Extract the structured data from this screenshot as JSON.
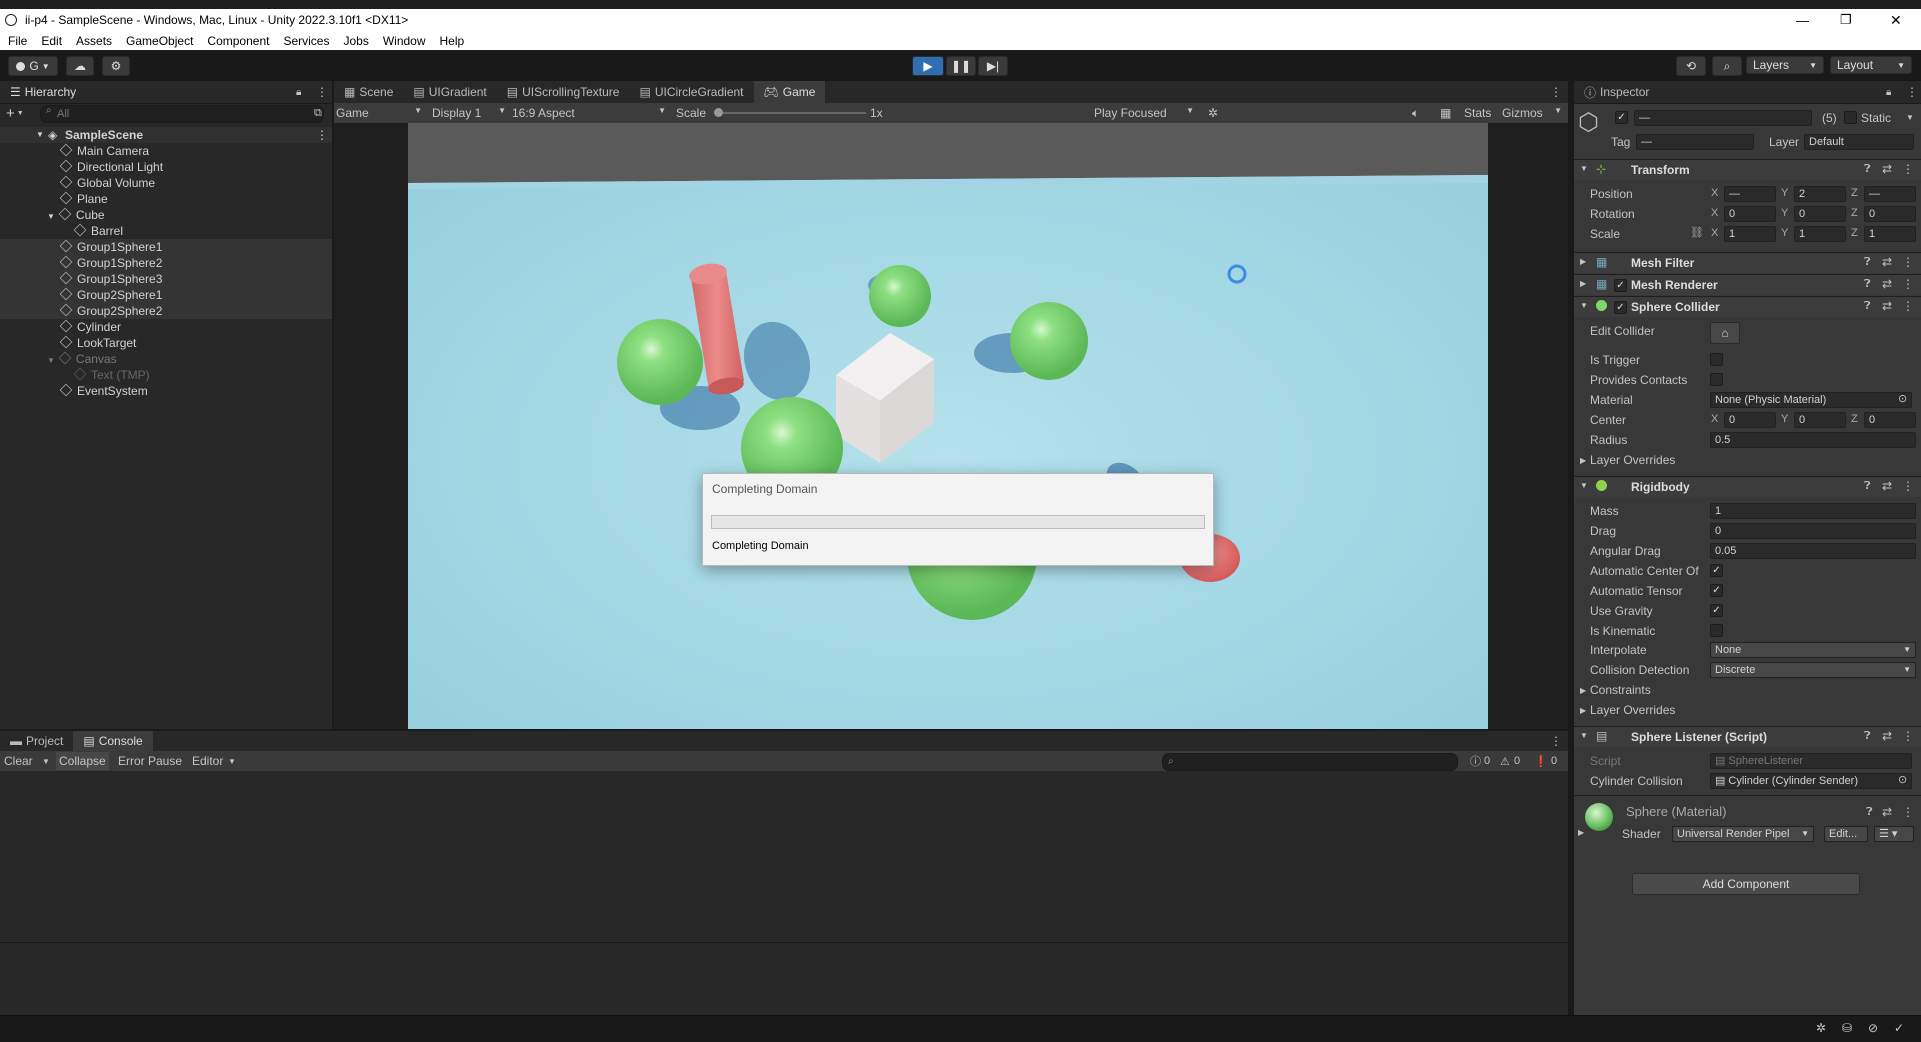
{
  "window": {
    "title": "ii-p4 - SampleScene - Windows, Mac, Linux - Unity 2022.3.10f1 <DX11>",
    "controls": [
      "—",
      "❐",
      "✕"
    ]
  },
  "menu": [
    "File",
    "Edit",
    "Assets",
    "GameObject",
    "Component",
    "Services",
    "Jobs",
    "Window",
    "Help"
  ],
  "toolbar": {
    "account": "G",
    "layers": "Layers",
    "layout": "Layout"
  },
  "hierarchy": {
    "tab": "Hierarchy",
    "search_placeholder": "All",
    "scene": "SampleScene",
    "items": [
      {
        "label": "Main Camera"
      },
      {
        "label": "Directional Light"
      },
      {
        "label": "Global Volume"
      },
      {
        "label": "Plane"
      },
      {
        "label": "Cube"
      },
      {
        "label": "Barrel"
      },
      {
        "label": "Group1Sphere1"
      },
      {
        "label": "Group1Sphere2"
      },
      {
        "label": "Group1Sphere3"
      },
      {
        "label": "Group2Sphere1"
      },
      {
        "label": "Group2Sphere2"
      },
      {
        "label": "Cylinder"
      },
      {
        "label": "LookTarget"
      },
      {
        "label": "Canvas"
      },
      {
        "label": "Text (TMP)"
      },
      {
        "label": "EventSystem"
      }
    ]
  },
  "center_tabs": [
    "Scene",
    "UIGradient",
    "UIScrollingTexture",
    "UICircleGradient",
    "Game"
  ],
  "game_bar": {
    "view": "Game",
    "display": "Display 1",
    "aspect": "16:9 Aspect",
    "scale_label": "Scale",
    "scale_value": "1x",
    "play_mode": "Play Focused",
    "stats": "Stats",
    "gizmos": "Gizmos"
  },
  "dialog": {
    "title": "Completing Domain",
    "message": "Completing Domain",
    "progress": 0.0
  },
  "bottom": {
    "tabs": [
      "Project",
      "Console"
    ],
    "clear": "Clear",
    "collapse": "Collapse",
    "error_pause": "Error Pause",
    "editor": "Editor",
    "counts": [
      "0",
      "0",
      "0"
    ]
  },
  "inspector": {
    "tab": "Inspector",
    "object_name": "—",
    "multi_count": "(5)",
    "static": "Static",
    "tag_label": "Tag",
    "tag_value": "—",
    "layer_label": "Layer",
    "layer_value": "Default",
    "transform": {
      "title": "Transform",
      "position_label": "Position",
      "rotation_label": "Rotation",
      "scale_label": "Scale",
      "position": [
        "—",
        "2",
        "—"
      ],
      "rotation": [
        "0",
        "0",
        "0"
      ],
      "scale": [
        "1",
        "1",
        "1"
      ]
    },
    "mesh_filter": "Mesh Filter",
    "mesh_renderer": "Mesh Renderer",
    "sphere_collider": {
      "title": "Sphere Collider",
      "edit_collider": "Edit Collider",
      "is_trigger": "Is Trigger",
      "provides_contacts": "Provides Contacts",
      "material_label": "Material",
      "material_value": "None (Physic Material)",
      "center_label": "Center",
      "center": [
        "0",
        "0",
        "0"
      ],
      "radius_label": "Radius",
      "radius": "0.5",
      "layer_overrides": "Layer Overrides"
    },
    "rigidbody": {
      "title": "Rigidbody",
      "mass_label": "Mass",
      "mass": "1",
      "drag_label": "Drag",
      "drag": "0",
      "angular_drag_label": "Angular Drag",
      "angular_drag": "0.05",
      "auto_com_label": "Automatic Center Of I",
      "auto_tensor_label": "Automatic Tensor",
      "use_gravity_label": "Use Gravity",
      "is_kinematic_label": "Is Kinematic",
      "interpolate_label": "Interpolate",
      "interpolate": "None",
      "collision_label": "Collision Detection",
      "collision": "Discrete",
      "constraints": "Constraints",
      "layer_overrides": "Layer Overrides"
    },
    "script": {
      "title": "Sphere Listener (Script)",
      "script_label": "Script",
      "script_value": "SphereListener",
      "cyl_label": "Cylinder Collision",
      "cyl_value": "Cylinder (Cylinder Sender)"
    },
    "material": {
      "name": "Sphere (Material)",
      "shader_label": "Shader",
      "shader_value": "Universal Render Pipel",
      "edit": "Edit..."
    },
    "add_component": "Add Component"
  },
  "colors": {
    "sky": "#a7d8e6",
    "sphere": "#7fdc74",
    "cylinder": "#e07070",
    "accent": "#3a8ee6"
  }
}
